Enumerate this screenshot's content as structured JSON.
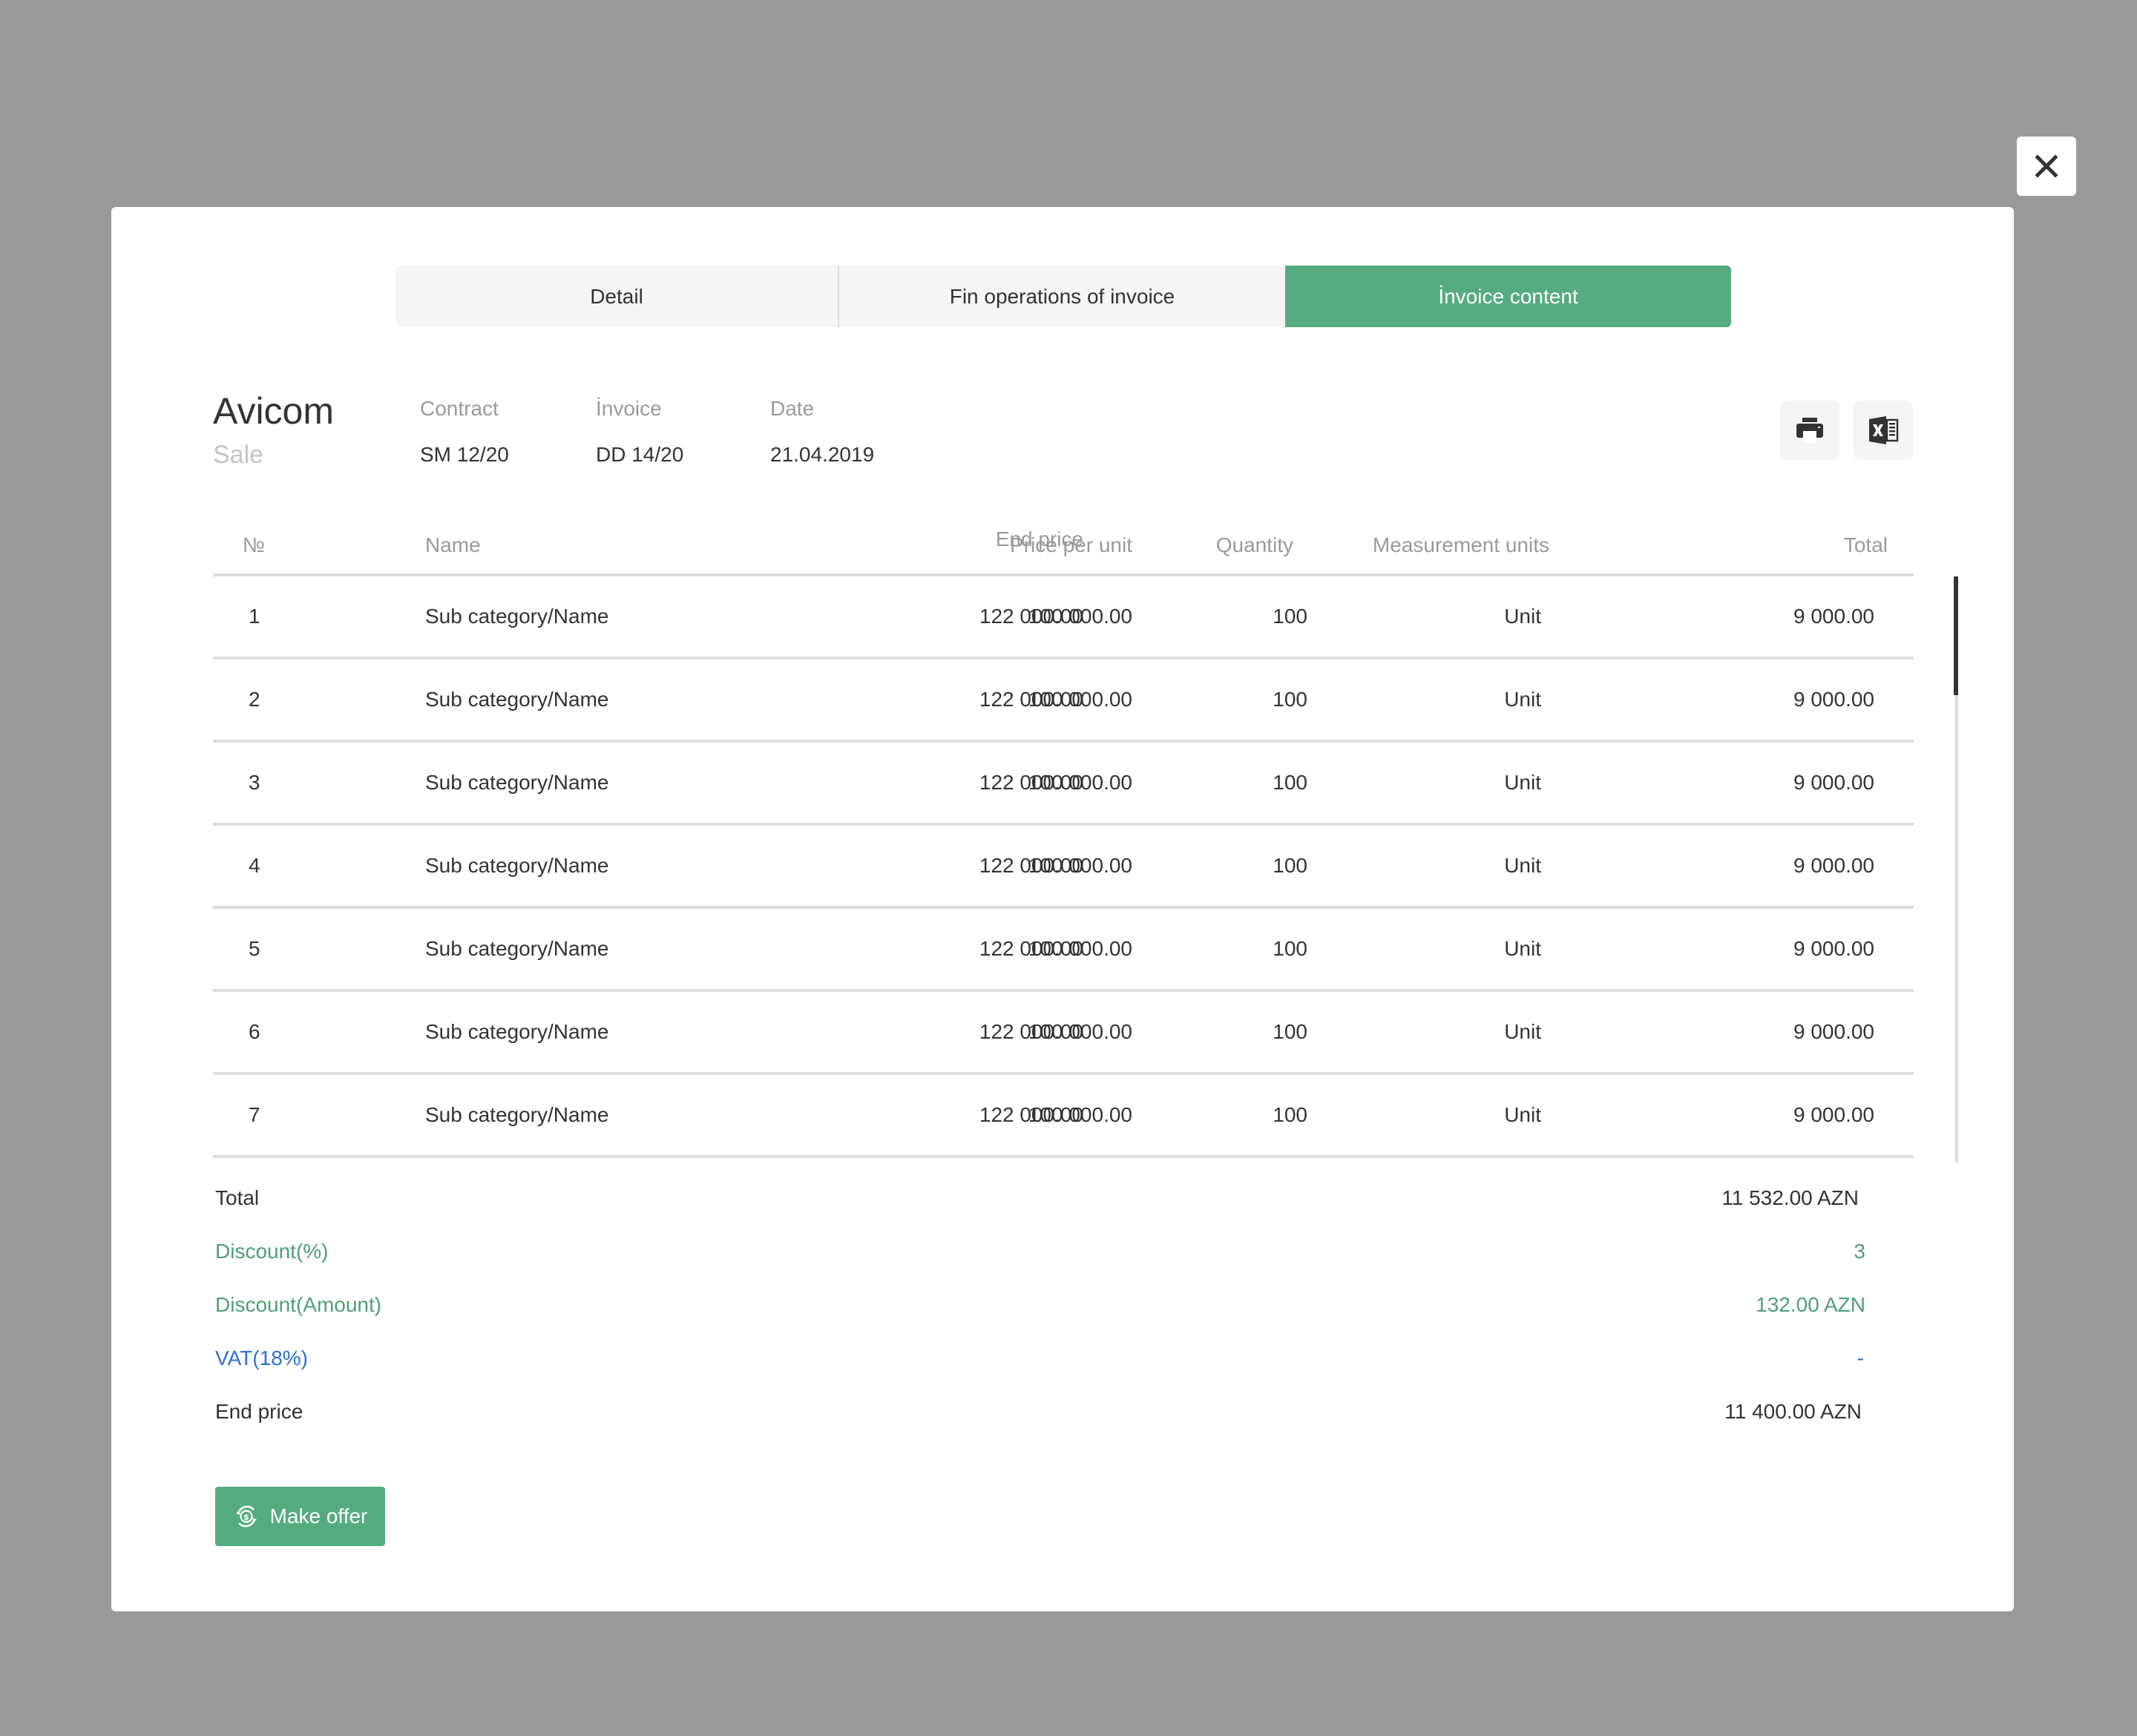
{
  "overlay": {
    "close_icon": "close-icon"
  },
  "tabs": [
    {
      "label": "Detail",
      "active": false
    },
    {
      "label": "Fin operations of invoice",
      "active": false
    },
    {
      "label": "İnvoice content",
      "active": true
    }
  ],
  "header": {
    "company": "Avicom",
    "type": "Sale",
    "fields": [
      {
        "label": "Contract",
        "value": "SM 12/20"
      },
      {
        "label": "İnvoice",
        "value": "DD 14/20"
      },
      {
        "label": "Date",
        "value": "21.04.2019"
      }
    ],
    "actions": [
      {
        "icon": "print-icon",
        "name": "print"
      },
      {
        "icon": "excel-icon",
        "name": "export-excel"
      }
    ]
  },
  "table": {
    "columns": [
      "№",
      "Name",
      "Price per unit",
      "End price",
      "Quantity",
      "Measurement units",
      "Total"
    ],
    "rows": [
      {
        "no": "1",
        "name": "Sub category/Name",
        "price_per_unit": "100 000.00",
        "end_price": "122 000.00",
        "quantity": "100",
        "unit": "Unit",
        "total": "9 000.00"
      },
      {
        "no": "2",
        "name": "Sub category/Name",
        "price_per_unit": "100 000.00",
        "end_price": "122 000.00",
        "quantity": "100",
        "unit": "Unit",
        "total": "9 000.00"
      },
      {
        "no": "3",
        "name": "Sub category/Name",
        "price_per_unit": "100 000.00",
        "end_price": "122 000.00",
        "quantity": "100",
        "unit": "Unit",
        "total": "9 000.00"
      },
      {
        "no": "4",
        "name": "Sub category/Name",
        "price_per_unit": "100 000.00",
        "end_price": "122 000.00",
        "quantity": "100",
        "unit": "Unit",
        "total": "9 000.00"
      },
      {
        "no": "5",
        "name": "Sub category/Name",
        "price_per_unit": "100 000.00",
        "end_price": "122 000.00",
        "quantity": "100",
        "unit": "Unit",
        "total": "9 000.00"
      },
      {
        "no": "6",
        "name": "Sub category/Name",
        "price_per_unit": "100 000.00",
        "end_price": "122 000.00",
        "quantity": "100",
        "unit": "Unit",
        "total": "9 000.00"
      },
      {
        "no": "7",
        "name": "Sub category/Name",
        "price_per_unit": "100 000.00",
        "end_price": "122 000.00",
        "quantity": "100",
        "unit": "Unit",
        "total": "9 000.00"
      }
    ]
  },
  "summary": {
    "total": {
      "label": "Total",
      "value": "11 532.00 AZN"
    },
    "discount_percent": {
      "label": "Discount(%)",
      "value": "3"
    },
    "discount_amount": {
      "label": "Discount(Amount)",
      "value": "132.00 AZN"
    },
    "vat": {
      "label": "VAT(18%)",
      "value": "-"
    },
    "end_price": {
      "label": "End price",
      "value": "11 400.00 AZN"
    }
  },
  "actions": {
    "make_offer": "Make offer"
  },
  "colors": {
    "accent": "#55ab80",
    "discount": "#4f9f74",
    "vat": "#2d6fd6",
    "overlay": "#999999"
  }
}
